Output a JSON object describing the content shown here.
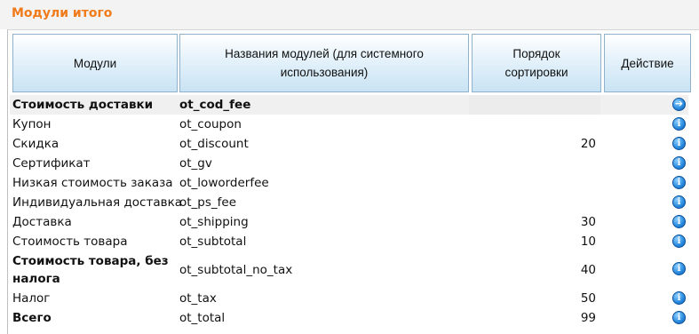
{
  "title": "Модули итого",
  "columns": {
    "modules": "Модули",
    "code": "Названия модулей (для системного использования)",
    "sort": "Порядок сортировки",
    "action": "Действие"
  },
  "rows": [
    {
      "name": "Стоимость доставки",
      "code": "ot_cod_fee",
      "sort": "",
      "icon": "arrow-right-icon",
      "bold": true
    },
    {
      "name": "Купон",
      "code": "ot_coupon",
      "sort": "",
      "icon": "info-icon",
      "bold": false
    },
    {
      "name": "Скидка",
      "code": "ot_discount",
      "sort": "20",
      "icon": "info-icon",
      "bold": false
    },
    {
      "name": "Сертификат",
      "code": "ot_gv",
      "sort": "",
      "icon": "info-icon",
      "bold": false
    },
    {
      "name": "Низкая стоимость заказа",
      "code": "ot_loworderfee",
      "sort": "",
      "icon": "info-icon",
      "bold": false
    },
    {
      "name": "Индивидуальная доставка",
      "code": "ot_ps_fee",
      "sort": "",
      "icon": "info-icon",
      "bold": false
    },
    {
      "name": "Доставка",
      "code": "ot_shipping",
      "sort": "30",
      "icon": "info-icon",
      "bold": false
    },
    {
      "name": "Стоимость товара",
      "code": "ot_subtotal",
      "sort": "10",
      "icon": "info-icon",
      "bold": false
    },
    {
      "name_line1": "Стоимость товара, без",
      "name_line2": "налога",
      "code": "ot_subtotal_no_tax",
      "sort": "40",
      "icon": "info-icon",
      "bold": true
    },
    {
      "name": "Налог",
      "code": "ot_tax",
      "sort": "50",
      "icon": "info-icon",
      "bold": false
    },
    {
      "name": "Всего",
      "code": "ot_total",
      "sort": "99",
      "icon": "info-icon",
      "bold": true
    }
  ]
}
